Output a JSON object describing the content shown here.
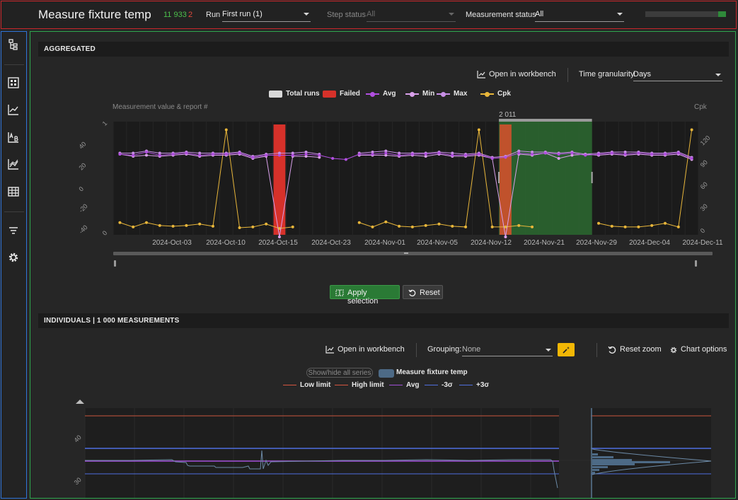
{
  "header": {
    "title": "Measure fixture temp",
    "count_pass": "11 933",
    "count_fail": "2",
    "run_label": "Run",
    "run_value": "First run (1)",
    "step_status_label": "Step status",
    "step_status_value": "All",
    "measurement_status_label": "Measurement status",
    "measurement_status_value": "All",
    "progress_fraction": 0.1
  },
  "sidebar": {
    "items": [
      "tree-icon",
      "dashboard-icon",
      "line-chart-icon",
      "axis-chart-icon",
      "trend-chart-icon",
      "table-icon",
      "filter-icon",
      "settings-icon"
    ]
  },
  "aggregated": {
    "section_title": "AGGREGATED",
    "open_workbench": "Open in workbench",
    "time_granularity_label": "Time granularity",
    "time_granularity_value": "Days",
    "apply_selection": "Apply selection",
    "reset": "Reset",
    "legend": [
      {
        "label": "Total runs",
        "color": "#d9d9d9",
        "kind": "rect"
      },
      {
        "label": "Failed",
        "color": "#d6312a",
        "kind": "rect"
      },
      {
        "label": "Avg",
        "color": "#b14fe0",
        "kind": "dot"
      },
      {
        "label": "Min",
        "color": "#d9a0ea",
        "kind": "dot"
      },
      {
        "label": "Max",
        "color": "#c88fe6",
        "kind": "dot"
      },
      {
        "label": "Cpk",
        "color": "#e8b63a",
        "kind": "dot"
      }
    ],
    "chart_data": {
      "type": "line",
      "ylabel_left": "Measurement value & report #",
      "ylabel_right": "Cpk",
      "x_ticks": [
        "2024-Oct-03",
        "2024-Oct-10",
        "2024-Oct-15",
        "2024-Oct-23",
        "2024-Nov-01",
        "2024-Nov-05",
        "2024-Nov-12",
        "2024-Nov-21",
        "2024-Nov-29",
        "2024-Dec-04",
        "2024-Dec-11"
      ],
      "y_left_ticks": [
        "40",
        "20",
        "0",
        "-20",
        "-40"
      ],
      "y_report_ticks": [
        "1",
        "0"
      ],
      "y_right_ticks": [
        "120",
        "90",
        "60",
        "30",
        "0"
      ],
      "annotation": "2 011",
      "failed_days": [
        12,
        29
      ],
      "selection_range": [
        29,
        36
      ],
      "days": 44,
      "avg": [
        34,
        33,
        36,
        33,
        34,
        35,
        33,
        34,
        34,
        35,
        31,
        33,
        33,
        33,
        34,
        33,
        30,
        29,
        34,
        34,
        35,
        33,
        34,
        34,
        35,
        33,
        33,
        34,
        30,
        31,
        35,
        34,
        35,
        34,
        35,
        33,
        34,
        35,
        34,
        35,
        34,
        34,
        35,
        30
      ],
      "min": [
        34,
        32,
        33,
        32,
        33,
        34,
        32,
        33,
        33,
        34,
        30,
        32,
        -44,
        32,
        32,
        31,
        null,
        null,
        33,
        33,
        33,
        32,
        33,
        32,
        34,
        32,
        32,
        33,
        30,
        -44,
        34,
        33,
        35,
        30,
        33,
        34,
        33,
        34,
        33,
        34,
        33,
        33,
        34,
        29
      ],
      "max": [
        35,
        35,
        37,
        35,
        35,
        36,
        35,
        35,
        35,
        36,
        32,
        34,
        35,
        35,
        36,
        34,
        null,
        null,
        35,
        36,
        37,
        35,
        35,
        35,
        36,
        35,
        34,
        35,
        31,
        32,
        37,
        36,
        36,
        35,
        36,
        34,
        35,
        36,
        36,
        36,
        35,
        35,
        36,
        31
      ],
      "cpk": [
        8,
        2,
        8,
        4,
        3,
        4,
        6,
        3,
        135,
        1,
        2,
        6,
        0,
        2,
        null,
        null,
        null,
        null,
        8,
        2,
        9,
        3,
        2,
        4,
        6,
        3,
        2,
        135,
        2,
        2,
        4,
        2,
        null,
        null,
        null,
        null,
        7,
        3,
        2,
        2,
        4,
        7,
        2,
        135
      ]
    }
  },
  "individuals": {
    "section_title": "INDIVIDUALS | 1 000 MEASUREMENTS",
    "open_workbench": "Open in workbench",
    "grouping_label": "Grouping:",
    "grouping_value": "None",
    "reset_zoom": "Reset zoom",
    "chart_options": "Chart options",
    "show_hide": "Show/hide all series",
    "series_name": "Measure fixture temp",
    "legend": [
      {
        "label": "Low limit",
        "color": "#d6553f"
      },
      {
        "label": "High limit",
        "color": "#d6553f"
      },
      {
        "label": "Avg",
        "color": "#a24fd8"
      },
      {
        "label": "-3σ",
        "color": "#4f6fe0"
      },
      {
        "label": "+3σ",
        "color": "#4f6fe0"
      }
    ],
    "chart_data": {
      "type": "line",
      "y_ticks": [
        "40",
        "30"
      ],
      "series": [
        {
          "name": "Measure fixture temp"
        }
      ]
    }
  }
}
